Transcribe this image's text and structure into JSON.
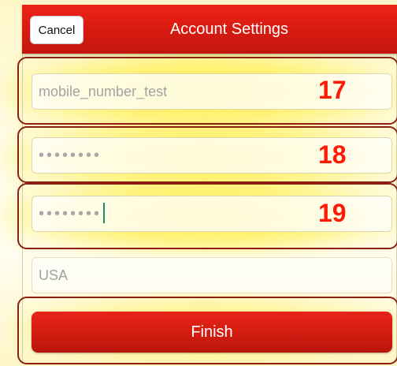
{
  "header": {
    "title": "Account Settings",
    "cancel_label": "Cancel"
  },
  "fields": {
    "username_value": "mobile_number_test",
    "password_masked": "••••••••",
    "confirm_password_masked": "••••••••",
    "country_placeholder": "USA"
  },
  "annotations": {
    "row1": "17",
    "row2": "18",
    "row3": "19"
  },
  "actions": {
    "finish_label": "Finish"
  },
  "colors": {
    "header_red": "#d61a10",
    "annotation_red": "#ff1a06",
    "highlight_yellow": "#ffec3c",
    "caret": "#1a8d7a"
  }
}
